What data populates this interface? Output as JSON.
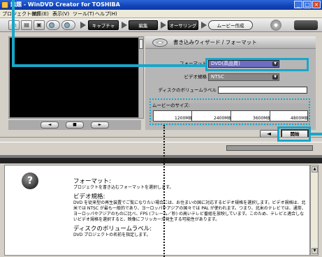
{
  "window": {
    "title": "無題 - WinDVD Creator for TOSHIBA",
    "controls": [
      "_",
      "□",
      "×"
    ]
  },
  "menu": [
    "プロジェクト(P)",
    "編集(E)",
    "表示(V)",
    "ツール(T)",
    "ヘルプ(H)"
  ],
  "toolbar": {
    "tabs": [
      "キャプチャ",
      "編集",
      "オーサリング",
      "ムービー作成"
    ],
    "active_tab": "ムービー作成"
  },
  "preview": {
    "buttons": [
      "",
      "",
      ""
    ]
  },
  "wizard": {
    "title": "書き込みウィザード / フォーマット",
    "format_label": "フォーマット",
    "format_value": "DVD(高品質)",
    "video_label": "ビデオ規格",
    "video_value": "NTSC",
    "volume_label": "ディスクのボリュームラベル",
    "volume_value": "",
    "size_label": "ムービーのサイズ:",
    "size_ticks": [
      "1200MB",
      "2400MB",
      "3600MB",
      "4800MB"
    ],
    "size_fill_fraction": 0.0,
    "back_label": "◄",
    "start_label": "開始"
  },
  "help": {
    "icon": "question-icon",
    "sections": [
      {
        "heading": "フォーマット:",
        "body": "プロジェクトを書き込むフォーマットを選択します。"
      },
      {
        "heading": "ビデオ規格:",
        "body": "DVD を従来型の再生装置でご覧になりたい場合には、お住まいの国に対応するビデオ規格を選択します。ビデオ規格は、北米では NTSC が最も一般的であり、ヨーロッパやアジアの国々では PAL が使われます。つまり、北米のテレビでは、通常、ヨーロッパやアジアのものに比べ、FPS (フレーム／秒) の高いテレビ番組を放映しています。このため、テレビと適合しないビデオ規格を選択すると、映像にフリッカーが発生する可能性があります。"
      },
      {
        "heading": "ディスクのボリュームラベル:",
        "body": "DVD プロジェクトの名前を指定します。"
      }
    ]
  },
  "colors": {
    "annotation": "#1aa6c8",
    "title_bar": "#1244b8"
  }
}
